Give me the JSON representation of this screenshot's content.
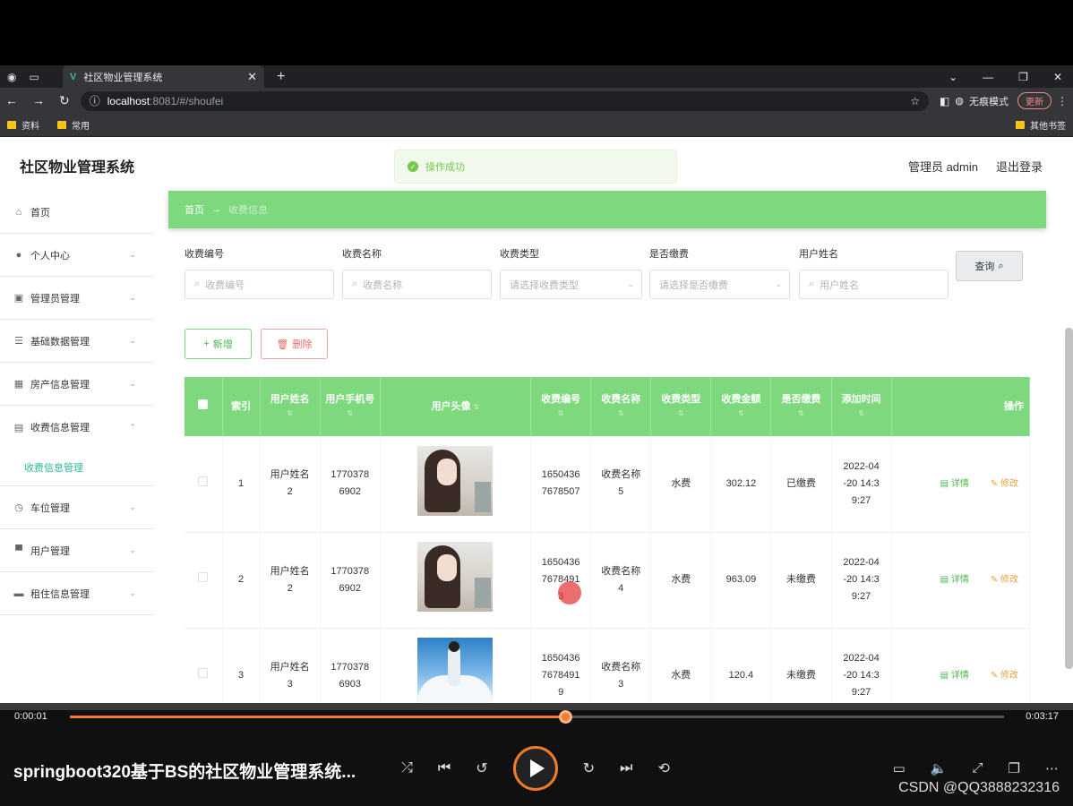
{
  "browser": {
    "tab_title": "社区物业管理系统",
    "tab_close": "✕",
    "new_tab": "+",
    "url_host": "localhost",
    "url_path": ":8081/#/shoufei",
    "incognito": "无痕模式",
    "update": "更新",
    "bookmarks": [
      "资料",
      "常用"
    ],
    "bookmark_other": "其他书签"
  },
  "app": {
    "title": "社区物业管理系统",
    "toast": "操作成功",
    "user_label": "管理员 admin",
    "logout": "退出登录"
  },
  "sidebar": {
    "items": [
      {
        "label": "首页",
        "icon": "home-icon"
      },
      {
        "label": "个人中心",
        "icon": "user-icon"
      },
      {
        "label": "管理员管理",
        "icon": "admin-icon"
      },
      {
        "label": "基础数据管理",
        "icon": "list-icon"
      },
      {
        "label": "房产信息管理",
        "icon": "grid-icon"
      },
      {
        "label": "收费信息管理",
        "icon": "doc-icon"
      },
      {
        "label": "车位管理",
        "icon": "clock-icon"
      },
      {
        "label": "用户管理",
        "icon": "user-manage-icon"
      },
      {
        "label": "租住信息管理",
        "icon": "monitor-icon"
      }
    ],
    "sub_active": "收费信息管理"
  },
  "breadcrumb": {
    "home": "首页",
    "current": "收费信息"
  },
  "filters": {
    "f1_label": "收费编号",
    "f1_placeholder": "收费编号",
    "f2_label": "收费名称",
    "f2_placeholder": "收费名称",
    "f3_label": "收费类型",
    "f3_placeholder": "请选择收费类型",
    "f4_label": "是否缴费",
    "f4_placeholder": "请选择是否缴费",
    "f5_label": "用户姓名",
    "f5_placeholder": "用户姓名",
    "query": "查询"
  },
  "actions": {
    "add": "新增",
    "delete": "删除"
  },
  "table": {
    "headers": {
      "index": "索引",
      "user_name": "用户姓名",
      "user_phone": "用户手机号",
      "avatar": "用户头像",
      "fee_no": "收费编号",
      "fee_name": "收费名称",
      "fee_type": "收费类型",
      "amount": "收费金额",
      "paid": "是否缴费",
      "added": "添加时间",
      "ops": "操作"
    },
    "rows": [
      {
        "index": "1",
        "name_a": "用户姓名",
        "name_b": "2",
        "phone_a": "1770378",
        "phone_b": "6902",
        "fee_a": "1650436",
        "fee_b": "7678507",
        "fee_c": "",
        "fname_a": "收费名称",
        "fname_b": "5",
        "type": "水费",
        "amount": "302.12",
        "paid": "已缴费",
        "t1": "2022-04",
        "t2": "-20 14:3",
        "t3": "9:27"
      },
      {
        "index": "2",
        "name_a": "用户姓名",
        "name_b": "2",
        "phone_a": "1770378",
        "phone_b": "6902",
        "fee_a": "1650436",
        "fee_b": "7678491",
        "fee_c": "3",
        "fname_a": "收费名称",
        "fname_b": "4",
        "type": "水费",
        "amount": "963.09",
        "paid": "未缴费",
        "t1": "2022-04",
        "t2": "-20 14:3",
        "t3": "9:27"
      },
      {
        "index": "3",
        "name_a": "用户姓名",
        "name_b": "3",
        "phone_a": "1770378",
        "phone_b": "6903",
        "fee_a": "1650436",
        "fee_b": "7678491",
        "fee_c": "9",
        "fname_a": "收费名称",
        "fname_b": "3",
        "type": "水费",
        "amount": "120.4",
        "paid": "未缴费",
        "t1": "2022-04",
        "t2": "-20 14:3",
        "t3": "9:27"
      }
    ],
    "detail": "详情",
    "edit": "修改"
  },
  "player": {
    "current_time": "0:00:01",
    "total_time": "0:03:17",
    "progress_fraction": 0.53,
    "title": "springboot320基于BS的社区物业管理系统...",
    "watermark": "CSDN @QQ3888232316"
  },
  "colors": {
    "accent": "#7ed87e",
    "player_accent": "#f07b2a"
  }
}
